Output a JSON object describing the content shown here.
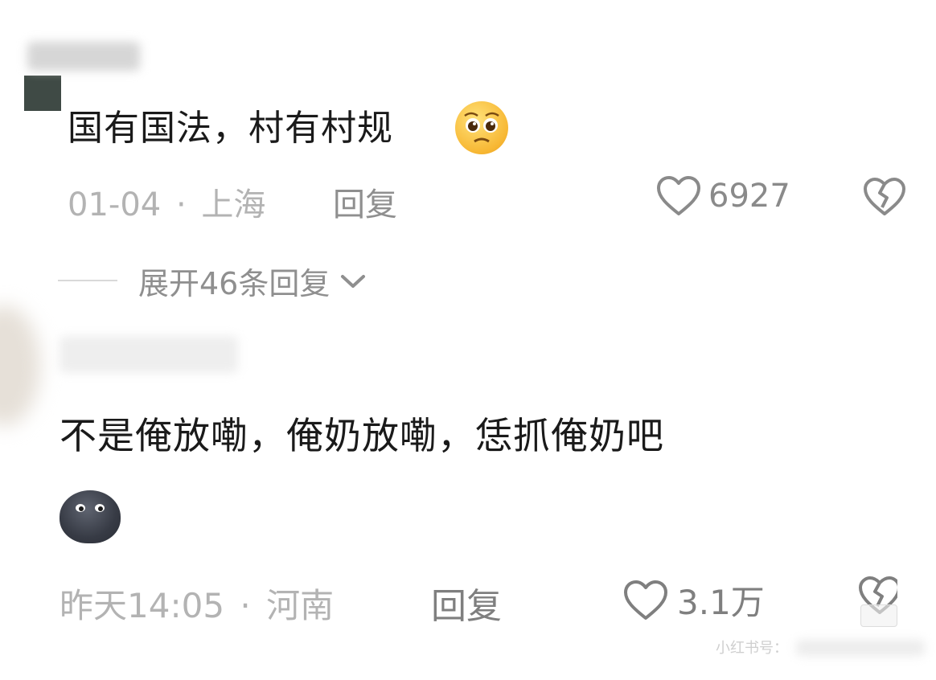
{
  "comments": [
    {
      "text": "国有国法，村有村规",
      "emoji": "pleading-face-icon",
      "date": "01-04",
      "separator": "·",
      "location": "上海",
      "reply_label": "回复",
      "likes": "6927"
    },
    {
      "text": "不是俺放嘞，俺奶放嘞，恁抓俺奶吧",
      "emoji": "dark-blob-emoji-icon",
      "date": "昨天14:05",
      "separator": "·",
      "location": "河南",
      "reply_label": "回复",
      "likes": "3.1万"
    }
  ],
  "expand_replies": {
    "label": "展开46条回复"
  },
  "watermark": {
    "text": "小红书号："
  }
}
